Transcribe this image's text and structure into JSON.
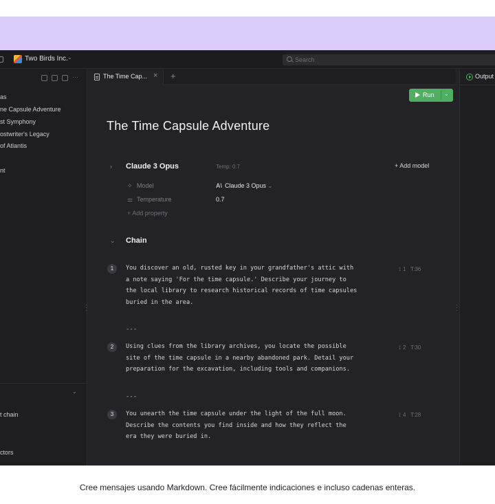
{
  "topbar": {
    "org_name": "Two Birds Inc.",
    "search_placeholder": "Search"
  },
  "sidebar": {
    "items": [
      {
        "label": "as"
      },
      {
        "label": "ne Capsule Adventure"
      },
      {
        "label": "st Symphony"
      },
      {
        "label": "ostwriter's Legacy"
      },
      {
        "label": " of Atlantis"
      },
      {
        "label": "nt"
      }
    ],
    "bottom_items": [
      {
        "label": "t chain"
      },
      {
        "label": "ctors"
      }
    ]
  },
  "tab": {
    "label": "The Time Cap...",
    "add": "+"
  },
  "editor": {
    "run_label": "Run",
    "title": "The Time Capsule Adventure",
    "model": {
      "name": "Claude 3 Opus",
      "temp_hint": "Temp: 0.7",
      "add_model": "+ Add model",
      "properties": [
        {
          "icon": "✧",
          "key": "Model",
          "value": "Claude 3 Opus",
          "value_prefix": "A\\",
          "has_chevron": true
        },
        {
          "icon": "⚌",
          "key": "Temperature",
          "value": "0.7"
        }
      ],
      "add_property": "+ Add property"
    },
    "chain": {
      "label": "Chain",
      "separator": "---",
      "steps": [
        {
          "number": "1",
          "text": "You discover an old, rusted key in your grandfather's attic with\na note saying 'For the time capsule.' Describe your journey to\nthe local library to research historical records of time capsules\nburied in the area.",
          "branches": "1",
          "tokens": "T:36"
        },
        {
          "number": "2",
          "text": "Using clues from the library archives, you locate the possible\nsite of the time capsule in a nearby abandoned park. Detail your\npreparation for the excavation, including tools and companions.",
          "branches": "2",
          "tokens": "T:30"
        },
        {
          "number": "3",
          "text": "You unearth the time capsule under the light of the full moon.\nDescribe the contents you find inside and how they reflect the\nera they were buried in.",
          "branches": "4",
          "tokens": "T:28"
        }
      ]
    }
  },
  "output": {
    "label": "Output"
  },
  "caption": "Cree mensajes usando Markdown. Cree fácilmente indicaciones e incluso cadenas enteras.",
  "colors": {
    "accent_green": "#4fae60",
    "lavender_band": "#dcccf8",
    "app_bg": "#232327"
  }
}
